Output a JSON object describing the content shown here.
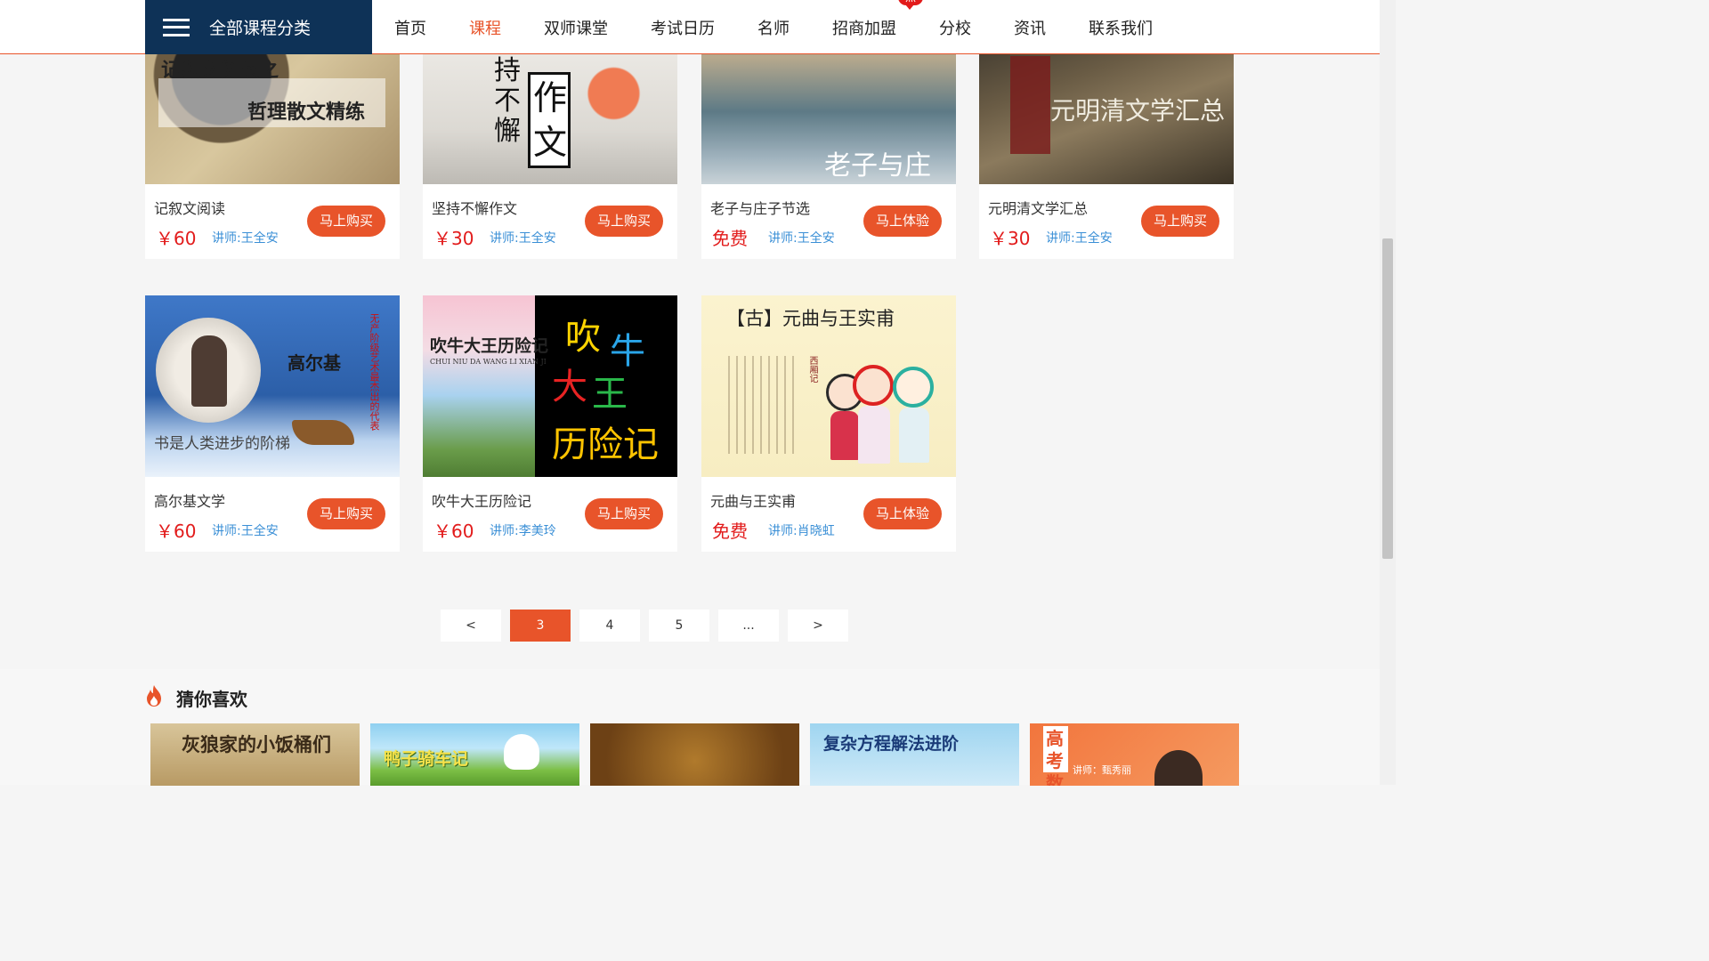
{
  "header": {
    "category_button": "全部课程分类",
    "nav": [
      "首页",
      "课程",
      "双师课堂",
      "考试日历",
      "名师",
      "招商加盟",
      "分校",
      "资讯",
      "联系我们"
    ],
    "active_nav": "课程",
    "hot_badge": "热"
  },
  "courses": [
    {
      "title": "记叙文阅读",
      "price": "￥60",
      "teacher": "讲师:王全安",
      "button": "马上购买",
      "img_text": [
        "记叙文阅读之",
        "哲理散文精练"
      ]
    },
    {
      "title": "坚持不懈作文",
      "price": "￥30",
      "teacher": "讲师:王全安",
      "button": "马上购买",
      "img_text": [
        "持",
        "不",
        "懈",
        "作",
        "文"
      ]
    },
    {
      "title": "老子与庄子节选",
      "price": "免费",
      "teacher": "讲师:王全安",
      "button": "马上体验",
      "img_text": [
        "老子与庄子"
      ]
    },
    {
      "title": "元明清文学汇总",
      "price": "￥30",
      "teacher": "讲师:王全安",
      "button": "马上购买",
      "img_text": [
        "元明清文学汇总"
      ]
    },
    {
      "title": "高尔基文学",
      "price": "￥60",
      "teacher": "讲师:王全安",
      "button": "马上购买",
      "img_text": [
        "高尔基",
        "书是人类进步的阶梯",
        "无产阶级艺术最杰出的代表"
      ]
    },
    {
      "title": "吹牛大王历险记",
      "price": "￥60",
      "teacher": "讲师:李美玲",
      "button": "马上购买",
      "img_text": [
        "吹牛大王历险记",
        "CHUI NIU DA WANG LI XIAN JI",
        "吹",
        "牛",
        "大",
        "王",
        "历险记"
      ]
    },
    {
      "title": "元曲与王实甫",
      "price": "免费",
      "teacher": "讲师:肖晓虹",
      "button": "马上体验",
      "img_text": [
        "【古】元曲与王实甫",
        "西厢记"
      ]
    }
  ],
  "pagination": {
    "prev": "<",
    "pages": [
      "3",
      "4",
      "5",
      "..."
    ],
    "next": ">",
    "current": "3"
  },
  "guess": {
    "title": "猜你喜欢",
    "items": [
      {
        "img_text": "灰狼家的小饭桶们"
      },
      {
        "img_text": "鸭子骑车记"
      },
      {
        "img_text": ""
      },
      {
        "img_text": "复杂方程解法进阶"
      },
      {
        "img_text": "高考 数学",
        "sub": "讲师：甄秀丽"
      }
    ]
  },
  "colors": {
    "accent": "#e8542a",
    "nav_dark": "#0e3257",
    "price_red": "#e21b1b",
    "teacher_blue": "#3a8fd6"
  }
}
